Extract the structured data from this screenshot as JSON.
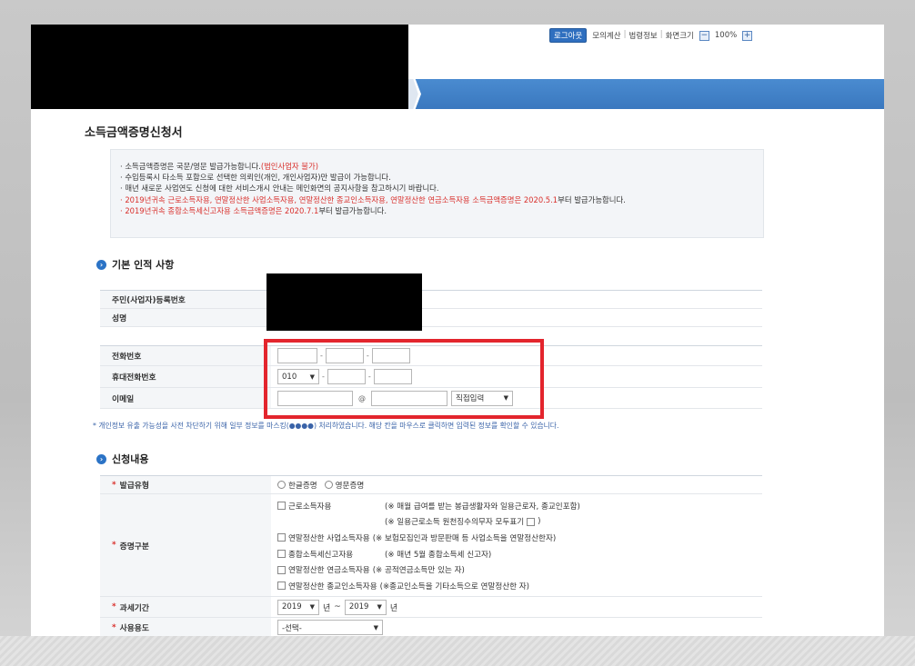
{
  "utility": {
    "logout": "로그아웃",
    "links": [
      "모의계산",
      "법령정보",
      "화면크기"
    ],
    "zoom_minus": "−",
    "zoom_level": "100%",
    "zoom_plus": "+"
  },
  "page_title": "소득금액증명신청서",
  "notice": [
    {
      "pre": "· 소득금액증명은 국문/영문 발급가능합니다.",
      "red": "(법인사업자 불가)",
      "post": ""
    },
    {
      "pre": "· 수입등록시 타소득 포함으로 선택한 의뢰인(개인, 개인사업자)만 발급이 가능합니다.",
      "red": "",
      "post": ""
    },
    {
      "pre": "· 매년 새로운 사업연도 신청에 대한 서비스개시 안내는 메인화면의 공지사항을 참고하시기 바랍니다.",
      "red": "",
      "post": ""
    },
    {
      "pre": "",
      "red": "· 2019년귀속 근로소득자용, 연말정산한 사업소득자용, 연말정산한 종교인소득자용, 연말정산한 연금소득자용 소득금액증명은 2020.5.1",
      "post": "부터 발급가능합니다."
    },
    {
      "pre": "",
      "red": "· 2019년귀속 종합소득세신고자용 소득금액증명은 2020.7.1",
      "post": "부터 발급가능합니다."
    }
  ],
  "basic_section": {
    "title": "기본 인적 사항",
    "rows": {
      "rrn": "주민(사업자)등록번호",
      "name": "성명",
      "phone": "전화번호",
      "mobile": "휴대전화번호",
      "email": "이메일"
    },
    "mobile_prefix": "010",
    "email_at": "@",
    "email_domain_select": "직접입력",
    "dash": "-"
  },
  "mask_note": "* 개인정보 유출 가능성을 사전 차단하기 위해 일부 정보를 마스킹(●●●●) 처리하였습니다. 해당 칸을 마우스로 클릭하면 입력된 정보를 확인할 수 있습니다.",
  "request_section": {
    "title": "신청내용",
    "req_mark": "*",
    "issue_type": {
      "label": "발급유형",
      "options": [
        "한글증명",
        "영문증명"
      ]
    },
    "cert_type": {
      "label": "증명구분",
      "items": [
        {
          "label": "근로소득자용",
          "note": "(※ 매월 급여를 받는 봉급생활자와 일용근로자, 종교인포함)"
        },
        {
          "label": "",
          "note": "(※ 일용근로소득 원천징수의무자 모두표기",
          "note_after": ")"
        },
        {
          "label": "연말정산한 사업소득자용",
          "note": "(※ 보험모집인과 방문판매 등 사업소득을 연말정산한자)"
        },
        {
          "label": "종합소득세신고자용",
          "note": "(※ 매년 5월 종합소득세 신고자)"
        },
        {
          "label": "연말정산한 연금소득자용",
          "note": "(※ 공적연금소득만 있는 자)"
        },
        {
          "label": "연말정산한 종교인소득자용",
          "note": "(※종교인소득을 기타소득으로 연말정산한 자)"
        }
      ]
    },
    "period": {
      "label": "과세기간",
      "from_year": "2019",
      "year_suffix": "년",
      "tilde": "~",
      "to_year": "2019"
    },
    "purpose": {
      "label": "사용용도",
      "select": "-선택-"
    }
  },
  "arrow_glyph": "▼",
  "section_icon_glyph": "›"
}
